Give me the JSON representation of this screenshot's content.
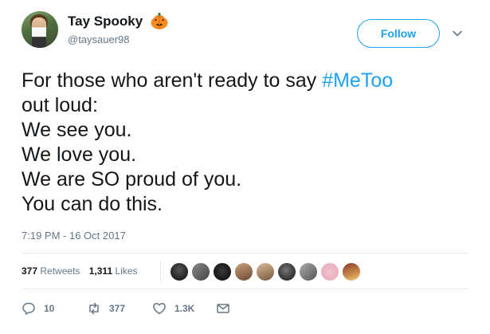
{
  "user": {
    "name": "Tay Spooky",
    "handle": "@taysauer98",
    "name_emoji": "jack-o-lantern-icon"
  },
  "follow_button": {
    "label": "Follow"
  },
  "tweet": {
    "lines": [
      {
        "text": "For those who aren't ready to say ",
        "hashtag": "#MeToo"
      },
      {
        "text": "out loud:"
      },
      {
        "text": "We see you."
      },
      {
        "text": "We love you."
      },
      {
        "text": "We are SO proud of you."
      },
      {
        "text": "You can do this."
      }
    ],
    "timestamp": "7:19 PM - 16 Oct 2017"
  },
  "stats": {
    "retweets_count": "377",
    "retweets_label": "Retweets",
    "likes_count": "1,311",
    "likes_label": "Likes"
  },
  "actions": {
    "reply_count": "10",
    "retweet_count": "377",
    "like_count": "1.3K"
  },
  "colors": {
    "accent": "#1da1f2",
    "secondary_text": "#657786",
    "primary_text": "#14171a"
  }
}
